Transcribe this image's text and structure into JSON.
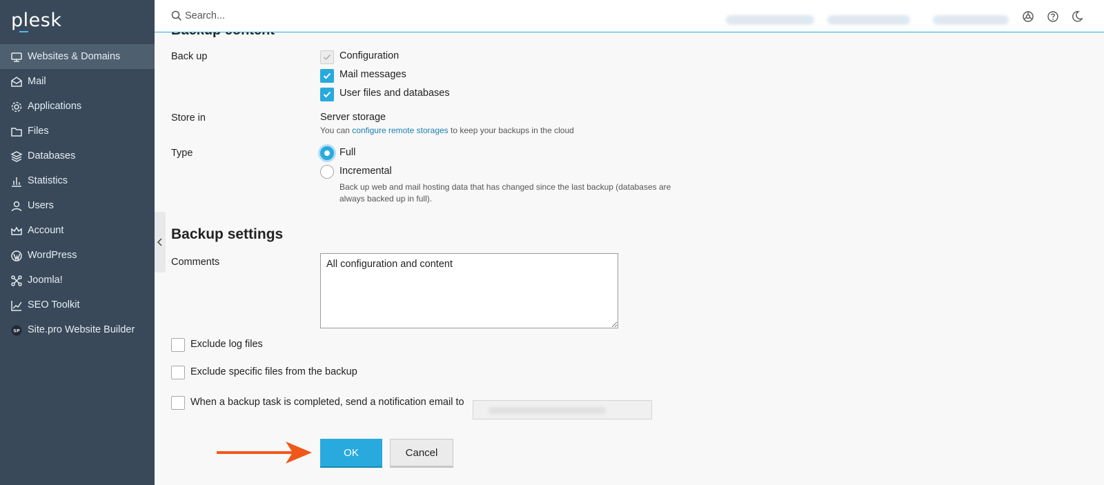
{
  "app": {
    "logo_text": "plesk"
  },
  "sidebar": {
    "items": [
      {
        "label": "Websites & Domains",
        "icon": "monitor-icon",
        "active": true
      },
      {
        "label": "Mail",
        "icon": "mail-icon"
      },
      {
        "label": "Applications",
        "icon": "gear-icon"
      },
      {
        "label": "Files",
        "icon": "folder-icon"
      },
      {
        "label": "Databases",
        "icon": "database-icon"
      },
      {
        "label": "Statistics",
        "icon": "bar-chart-icon"
      },
      {
        "label": "Users",
        "icon": "user-icon"
      },
      {
        "label": "Account",
        "icon": "crown-icon"
      },
      {
        "label": "WordPress",
        "icon": "wordpress-icon"
      },
      {
        "label": "Joomla!",
        "icon": "joomla-icon"
      },
      {
        "label": "SEO Toolkit",
        "icon": "seo-chart-icon"
      },
      {
        "label": "Site.pro Website Builder",
        "icon": "sitepro-icon"
      }
    ]
  },
  "topbar": {
    "search_placeholder": "Search..."
  },
  "backup_content": {
    "heading": "Backup content",
    "backup_label": "Back up",
    "options": [
      {
        "label": "Configuration",
        "checked": true,
        "disabled": true
      },
      {
        "label": "Mail messages",
        "checked": true
      },
      {
        "label": "User files and databases",
        "checked": true
      }
    ],
    "store_label": "Store in",
    "store_value": "Server storage",
    "store_hint_prefix": "You can ",
    "store_hint_link": "configure remote storages",
    "store_hint_suffix": " to keep your backups in the cloud",
    "type_label": "Type",
    "type_full": "Full",
    "type_incremental": "Incremental",
    "type_selected": "Full",
    "incremental_hint_line1": "Back up web and mail hosting data that has changed since the last backup (databases are",
    "incremental_hint_line2": "always backed up in full)."
  },
  "backup_settings": {
    "heading": "Backup settings",
    "comments_label": "Comments",
    "comments_value": "All configuration and content",
    "exclude_logs": "Exclude log files",
    "exclude_specific": "Exclude specific files from the backup",
    "notify_label": "When a backup task is completed, send a notification email to"
  },
  "buttons": {
    "ok": "OK",
    "cancel": "Cancel"
  },
  "colors": {
    "accent": "#28aade",
    "sidebar_bg": "#39495a",
    "arrow": "#f0581a"
  }
}
